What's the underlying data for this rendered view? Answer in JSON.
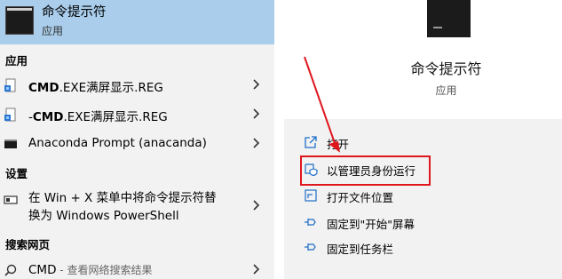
{
  "top_result": {
    "title": "命令提示符",
    "subtitle": "应用"
  },
  "sections": {
    "apps": "应用",
    "settings": "设置",
    "web": "搜索网页"
  },
  "app_items": [
    {
      "bold": "CMD",
      "rest": ".EXE满屏显示.REG",
      "prefix": "",
      "icon": "reg-file-icon"
    },
    {
      "bold": "CMD",
      "rest": ".EXE满屏显示.REG",
      "prefix": "-",
      "icon": "reg-file-icon"
    },
    {
      "bold": "",
      "rest": "Anaconda Prompt (anacanda)",
      "prefix": "",
      "icon": "terminal-icon"
    }
  ],
  "settings_item": {
    "line1": "在 Win + X 菜单中将命令提示符替",
    "line2": "换为 Windows PowerShell"
  },
  "web_item": {
    "query": "CMD",
    "hint": " - 查看网络搜索结果"
  },
  "detail": {
    "title": "命令提示符",
    "type": "应用"
  },
  "actions": [
    {
      "label": "打开",
      "icon": "open-icon"
    },
    {
      "label": "以管理员身份运行",
      "icon": "shield-admin-icon"
    },
    {
      "label": "打开文件位置",
      "icon": "folder-location-icon"
    },
    {
      "label": "固定到\"开始\"屏幕",
      "icon": "pin-icon"
    },
    {
      "label": "固定到任务栏",
      "icon": "pin-icon"
    }
  ],
  "colors": {
    "highlight": "#a9cdeb",
    "pane": "#f2f2f2",
    "annotation": "#e0161d",
    "accent_icon": "#1f6fc8"
  }
}
